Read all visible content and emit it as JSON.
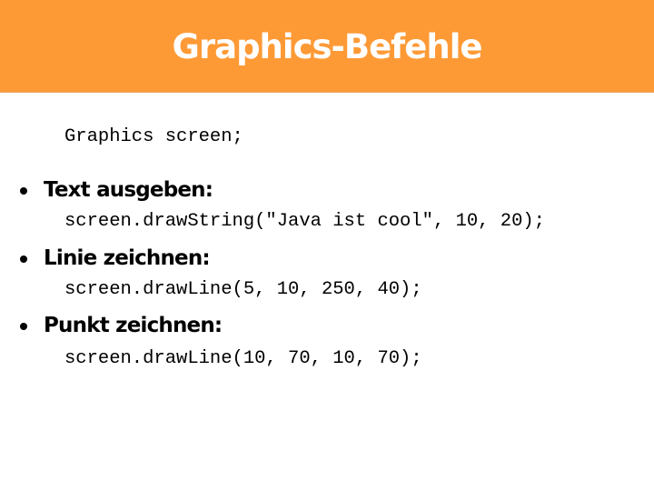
{
  "colors": {
    "header_background": "#fe9a36",
    "header_text": "#ffffff",
    "body_text": "#000000",
    "page_background": "#ffffff"
  },
  "header": {
    "title": "Graphics-Befehle"
  },
  "intro_code": "Graphics screen;",
  "bullets": [
    {
      "icon": "bullet-dot-icon",
      "label": "Text ausgeben:",
      "code": "screen.drawString(\"Java ist cool\", 10, 20);"
    },
    {
      "icon": "bullet-dot-icon",
      "label": "Linie zeichnen:",
      "code": "screen.drawLine(5, 10, 250, 40);"
    },
    {
      "icon": "bullet-dot-icon",
      "label": "Punkt zeichnen:",
      "code": "screen.drawLine(10, 70, 10, 70);"
    }
  ]
}
